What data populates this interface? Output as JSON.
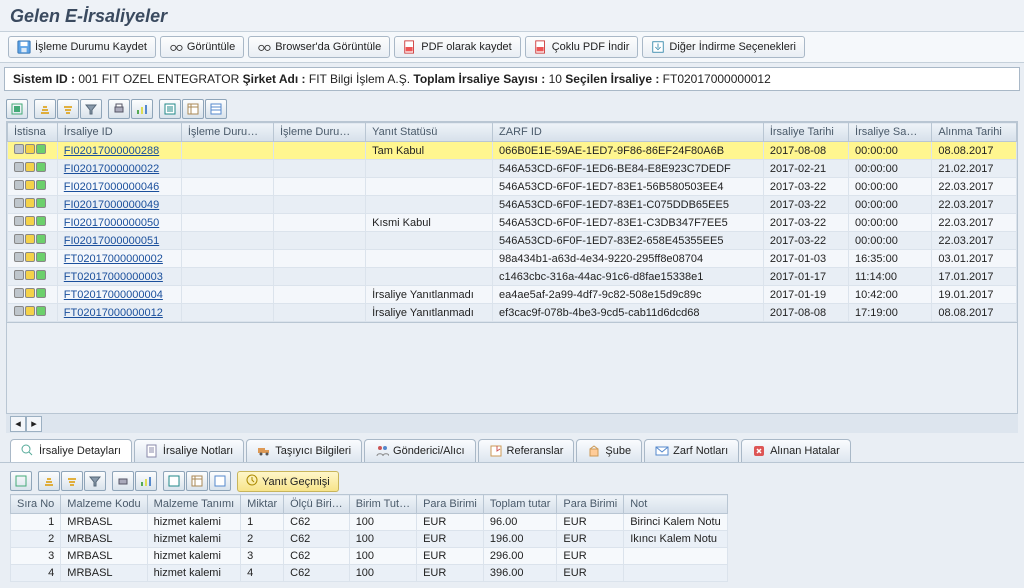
{
  "title": "Gelen E-İrsaliyeler",
  "toolbar": {
    "save": "İşleme Durumu Kaydet",
    "view": "Görüntüle",
    "browser": "Browser'da Görüntüle",
    "pdf": "PDF olarak kaydet",
    "multi_pdf": "Çoklu PDF İndir",
    "other": "Diğer İndirme Seçenekleri"
  },
  "sysbar": {
    "sys_label": "Sistem ID :",
    "sys_val": "001 FIT OZEL ENTEGRATOR",
    "comp_label": "Şirket Adı :",
    "comp_val": "FIT Bilgi İşlem A.Ş.",
    "total_label": "Toplam İrsaliye Sayısı :",
    "total_val": "10",
    "sel_label": "Seçilen İrsaliye :",
    "sel_val": "FT02017000000012"
  },
  "grid": {
    "headers": [
      "İstisna",
      "İrsaliye ID",
      "İşleme Duru…",
      "İşleme Duru…",
      "Yanıt Statüsü",
      "ZARF ID",
      "İrsaliye Tarihi",
      "İrsaliye Sa…",
      "Alınma Tarihi"
    ],
    "rows": [
      {
        "sel": true,
        "id": "FI02017000000288",
        "yanit": "Tam Kabul",
        "zarf": "066B0E1E-59AE-1ED7-9F86-86EF24F80A6B",
        "tarih": "2017-08-08",
        "saat": "00:00:00",
        "alinma": "08.08.2017"
      },
      {
        "sel": false,
        "id": "FI02017000000022",
        "yanit": "",
        "zarf": "546A53CD-6F0F-1ED6-BE84-E8E923C7DEDF",
        "tarih": "2017-02-21",
        "saat": "00:00:00",
        "alinma": "21.02.2017"
      },
      {
        "sel": false,
        "id": "FI02017000000046",
        "yanit": "",
        "zarf": "546A53CD-6F0F-1ED7-83E1-56B580503EE4",
        "tarih": "2017-03-22",
        "saat": "00:00:00",
        "alinma": "22.03.2017"
      },
      {
        "sel": false,
        "id": "FI02017000000049",
        "yanit": "",
        "zarf": "546A53CD-6F0F-1ED7-83E1-C075DDB65EE5",
        "tarih": "2017-03-22",
        "saat": "00:00:00",
        "alinma": "22.03.2017"
      },
      {
        "sel": false,
        "id": "FI02017000000050",
        "yanit": "Kısmi Kabul",
        "zarf": "546A53CD-6F0F-1ED7-83E1-C3DB347F7EE5",
        "tarih": "2017-03-22",
        "saat": "00:00:00",
        "alinma": "22.03.2017"
      },
      {
        "sel": false,
        "id": "FI02017000000051",
        "yanit": "",
        "zarf": "546A53CD-6F0F-1ED7-83E2-658E45355EE5",
        "tarih": "2017-03-22",
        "saat": "00:00:00",
        "alinma": "22.03.2017"
      },
      {
        "sel": false,
        "id": "FT02017000000002",
        "yanit": "",
        "zarf": "98a434b1-a63d-4e34-9220-295ff8e08704",
        "tarih": "2017-01-03",
        "saat": "16:35:00",
        "alinma": "03.01.2017"
      },
      {
        "sel": false,
        "id": "FT02017000000003",
        "yanit": "",
        "zarf": "c1463cbc-316a-44ac-91c6-d8fae15338e1",
        "tarih": "2017-01-17",
        "saat": "11:14:00",
        "alinma": "17.01.2017"
      },
      {
        "sel": false,
        "id": "FT02017000000004",
        "yanit": "İrsaliye Yanıtlanmadı",
        "zarf": "ea4ae5af-2a99-4df7-9c82-508e15d9c89c",
        "tarih": "2017-01-19",
        "saat": "10:42:00",
        "alinma": "19.01.2017"
      },
      {
        "sel": false,
        "id": "FT02017000000012",
        "yanit": "İrsaliye Yanıtlanmadı",
        "zarf": "ef3cac9f-078b-4be3-9cd5-cab11d6dcd68",
        "tarih": "2017-08-08",
        "saat": "17:19:00",
        "alinma": "08.08.2017"
      }
    ]
  },
  "tabs": {
    "detay": "İrsaliye Detayları",
    "notlar": "İrsaliye Notları",
    "tasiyici": "Taşıyıcı Bilgileri",
    "gonderici": "Gönderici/Alıcı",
    "referans": "Referanslar",
    "sube": "Şube",
    "zarf": "Zarf Notları",
    "hata": "Alınan Hatalar"
  },
  "detail": {
    "yanit_gecmisi": "Yanıt Geçmişi",
    "headers": [
      "Sıra No",
      "Malzeme Kodu",
      "Malzeme Tanımı",
      "Miktar",
      "Ölçü Biri…",
      "Birim Tut…",
      "Para Birimi",
      "Toplam tutar",
      "Para Birimi",
      "Not"
    ],
    "rows": [
      {
        "no": "1",
        "kod": "MRBASL",
        "tanim": "hizmet kalemi",
        "miktar": "1",
        "olcu": "C62",
        "birim": "100",
        "pb1": "EUR",
        "toplam": "96.00",
        "pb2": "EUR",
        "not": "Birinci Kalem Notu"
      },
      {
        "no": "2",
        "kod": "MRBASL",
        "tanim": "hizmet kalemi",
        "miktar": "2",
        "olcu": "C62",
        "birim": "100",
        "pb1": "EUR",
        "toplam": "196.00",
        "pb2": "EUR",
        "not": "Ikıncı Kalem Notu"
      },
      {
        "no": "3",
        "kod": "MRBASL",
        "tanim": "hizmet kalemi",
        "miktar": "3",
        "olcu": "C62",
        "birim": "100",
        "pb1": "EUR",
        "toplam": "296.00",
        "pb2": "EUR",
        "not": ""
      },
      {
        "no": "4",
        "kod": "MRBASL",
        "tanim": "hizmet kalemi",
        "miktar": "4",
        "olcu": "C62",
        "birim": "100",
        "pb1": "EUR",
        "toplam": "396.00",
        "pb2": "EUR",
        "not": ""
      }
    ]
  }
}
